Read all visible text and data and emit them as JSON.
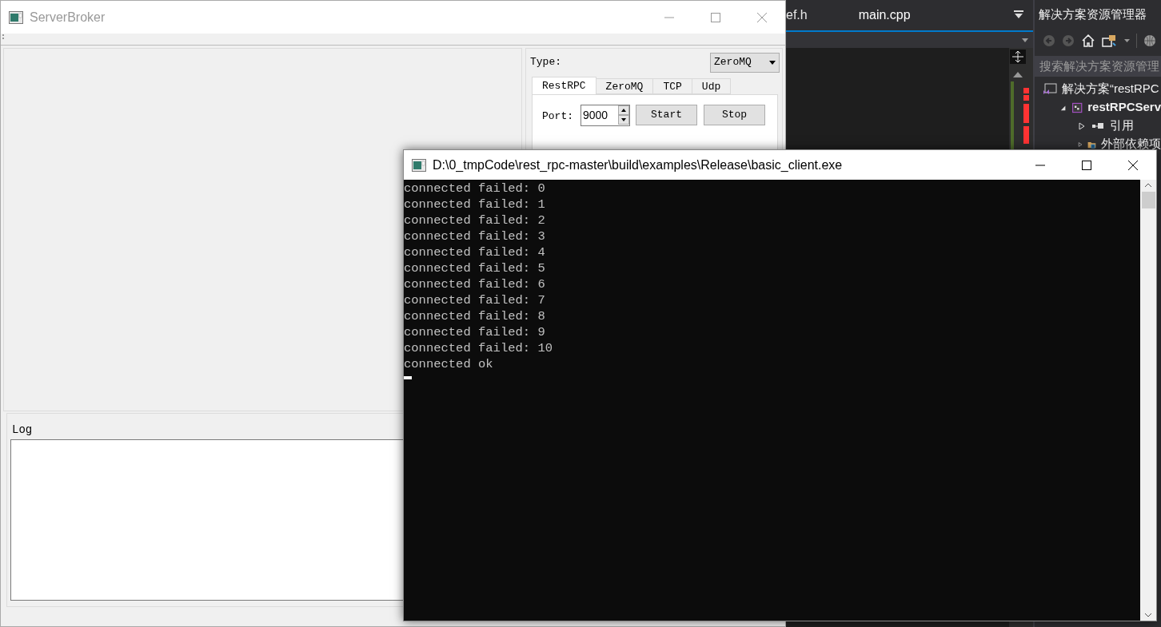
{
  "ide": {
    "tabs": [
      {
        "label": "ef.h",
        "selected": false
      },
      {
        "label": "main.cpp",
        "selected": true
      }
    ],
    "solution_explorer": {
      "title": "解决方案资源管理器",
      "search": {
        "placeholder": "搜索解决方案资源管理"
      },
      "tree": [
        {
          "label": "解决方案“restRPC",
          "kind": "solution",
          "children": [
            {
              "label": "restRPCServ",
              "kind": "project",
              "expanded": true,
              "children": [
                {
                  "label": "引用",
                  "kind": "references",
                  "expanded": false
                },
                {
                  "label": "外部依赖项",
                  "kind": "folder",
                  "expanded": false
                }
              ]
            }
          ]
        }
      ]
    }
  },
  "server_broker": {
    "title": "ServerBroker",
    "type_label": "Type:",
    "type_combo": "ZeroMQ",
    "tabs": [
      {
        "label": "RestRPC",
        "selected": true
      },
      {
        "label": "ZeroMQ",
        "selected": false
      },
      {
        "label": "TCP",
        "selected": false
      },
      {
        "label": "Udp",
        "selected": false
      }
    ],
    "port_label": "Port:",
    "port_value": "9000",
    "buttons": [
      "Start",
      "Stop"
    ],
    "log_label": "Log"
  },
  "console": {
    "title": "D:\\0_tmpCode\\rest_rpc-master\\build\\examples\\Release\\basic_client.exe",
    "lines": [
      "connected failed: 0",
      "connected failed: 1",
      "connected failed: 2",
      "connected failed: 3",
      "connected failed: 4",
      "connected failed: 5",
      "connected failed: 6",
      "connected failed: 7",
      "connected failed: 8",
      "connected failed: 9",
      "connected failed: 10",
      "connected ok"
    ]
  }
}
